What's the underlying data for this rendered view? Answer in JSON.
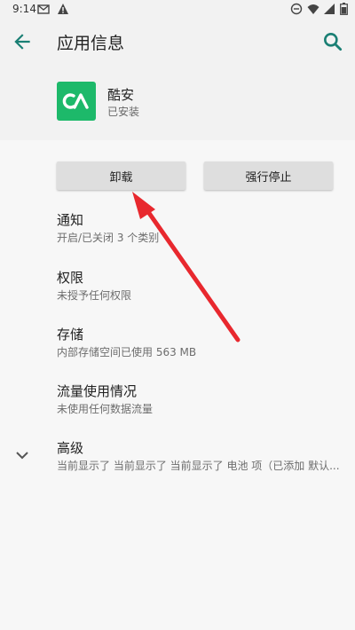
{
  "status_bar": {
    "time": "9:14",
    "icons": [
      "gmail-icon",
      "warning-icon",
      "dnd-icon",
      "wifi-icon",
      "signal-icon",
      "battery-icon"
    ]
  },
  "app_bar": {
    "title": "应用信息",
    "back_icon": "arrow-back-icon",
    "search_icon": "search-icon"
  },
  "app": {
    "name": "酷安",
    "status": "已安装",
    "icon_color": "#1db96a"
  },
  "buttons": {
    "uninstall": "卸载",
    "force_stop": "强行停止"
  },
  "items": [
    {
      "title": "通知",
      "subtitle": "开启/已关闭 3 个类别"
    },
    {
      "title": "权限",
      "subtitle": "未授予任何权限"
    },
    {
      "title": "存储",
      "subtitle": "内部存储空间已使用 563 MB"
    },
    {
      "title": "流量使用情况",
      "subtitle": "未使用任何数据流量"
    },
    {
      "title": "高级",
      "subtitle": "当前显示了 当前显示了 当前显示了 电池 项（已添加 默认..."
    }
  ],
  "annotation": {
    "color": "#e8282e"
  }
}
